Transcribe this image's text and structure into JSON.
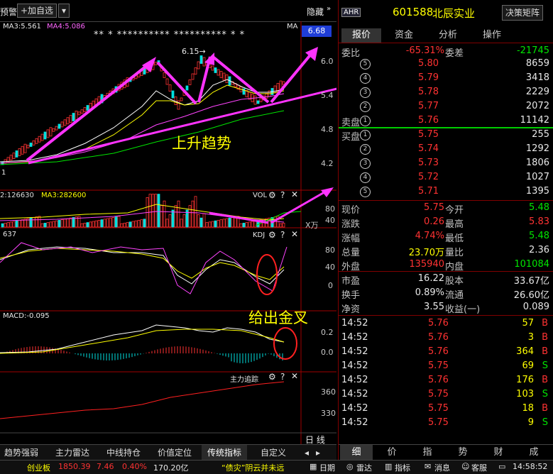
{
  "toolbar": {
    "alert_label": "预警",
    "add_fav_label": "+加自选",
    "hide_label": "隐藏"
  },
  "indicators": {
    "ma3_main": "MA3:5.561",
    "ma4_main": "MA4:5.086",
    "ma_tag": "MA",
    "price_box": "6.68",
    "peak_label": "6.15→",
    "stars": "** * ********** ********** * *",
    "vol_ma2": "2:126630",
    "vol_ma3": "MA3:282600",
    "vol_title": "VOL",
    "vol_unit": "X万",
    "kdj_value": "637",
    "kdj_title": "KDJ",
    "macd_value": "MACD:-0.095",
    "main_track": "主力追踪",
    "left_one": "1"
  },
  "y_axis": {
    "main": [
      "6.0",
      "5.4",
      "4.8",
      "4.2"
    ],
    "vol": [
      "80",
      "40"
    ],
    "kdj": [
      "80",
      "40",
      "0"
    ],
    "macd": [
      "0.2",
      "0.0"
    ],
    "track": [
      "360",
      "330"
    ]
  },
  "annotations": {
    "trend": "上升趋势",
    "golden_cross": "给出金叉"
  },
  "bottom_tabs": [
    "趋势强弱",
    "主力雷达",
    "中线持仓",
    "价值定位",
    "传统指标",
    "自定义"
  ],
  "day_line_label": "日 线",
  "stock": {
    "tag": "AHR",
    "code": "601588",
    "name": "北辰实业",
    "decision_btn": "决策矩阵"
  },
  "right_tabs": [
    "报价",
    "资金",
    "分析",
    "操作"
  ],
  "weibi": {
    "label1": "委比",
    "value1": "-65.31%",
    "label2": "委差",
    "value2": "-21745"
  },
  "sell_label": "卖盘",
  "buy_label": "买盘",
  "asks": [
    {
      "lvl": "5",
      "price": "5.80",
      "vol": "8659"
    },
    {
      "lvl": "4",
      "price": "5.79",
      "vol": "3418"
    },
    {
      "lvl": "3",
      "price": "5.78",
      "vol": "2229"
    },
    {
      "lvl": "2",
      "price": "5.77",
      "vol": "2072"
    },
    {
      "lvl": "1",
      "price": "5.76",
      "vol": "11142"
    }
  ],
  "bids": [
    {
      "lvl": "1",
      "price": "5.75",
      "vol": "255"
    },
    {
      "lvl": "2",
      "price": "5.74",
      "vol": "1292"
    },
    {
      "lvl": "3",
      "price": "5.73",
      "vol": "1806"
    },
    {
      "lvl": "4",
      "price": "5.72",
      "vol": "1027"
    },
    {
      "lvl": "5",
      "price": "5.71",
      "vol": "1395"
    }
  ],
  "stats": [
    {
      "l1": "现价",
      "v1": "5.75",
      "c1": "red",
      "l2": "今开",
      "v2": "5.48",
      "c2": "grn"
    },
    {
      "l1": "涨跌",
      "v1": "0.26",
      "c1": "red",
      "l2": "最高",
      "v2": "5.83",
      "c2": "red"
    },
    {
      "l1": "涨幅",
      "v1": "4.74%",
      "c1": "red",
      "l2": "最低",
      "v2": "5.48",
      "c2": "grn"
    },
    {
      "l1": "总量",
      "v1": "23.70万",
      "c1": "yel",
      "l2": "量比",
      "v2": "2.36",
      "c2": "wht"
    },
    {
      "l1": "外盘",
      "v1": "135940",
      "c1": "red",
      "l2": "内盘",
      "v2": "101084",
      "c2": "grn"
    }
  ],
  "fund": [
    {
      "l1": "市盈",
      "v1": "16.22",
      "l2": "股本",
      "v2": "33.67亿"
    },
    {
      "l1": "换手",
      "v1": "0.89%",
      "l2": "流通",
      "v2": "26.60亿"
    },
    {
      "l1": "净资",
      "v1": "3.55",
      "l2": "收益(一)",
      "v2": "0.089"
    }
  ],
  "ticks": [
    {
      "time": "14:52",
      "price": "5.76",
      "vol": "57",
      "dir": "B"
    },
    {
      "time": "14:52",
      "price": "5.76",
      "vol": "3",
      "dir": "B"
    },
    {
      "time": "14:52",
      "price": "5.76",
      "vol": "364",
      "dir": "B"
    },
    {
      "time": "14:52",
      "price": "5.75",
      "vol": "69",
      "dir": "S"
    },
    {
      "time": "14:52",
      "price": "5.76",
      "vol": "176",
      "dir": "B"
    },
    {
      "time": "14:52",
      "price": "5.75",
      "vol": "103",
      "dir": "S"
    },
    {
      "time": "14:52",
      "price": "5.75",
      "vol": "18",
      "dir": "B"
    },
    {
      "time": "14:52",
      "price": "5.75",
      "vol": "9",
      "dir": "S"
    }
  ],
  "detail_tabs": [
    "细",
    "价",
    "指",
    "势",
    "财",
    "成"
  ],
  "status": {
    "board": "创业板",
    "board_val": "1850.39",
    "board_chg": "7.46",
    "board_pct": "0.40%",
    "board_amt": "170.20亿",
    "news": "“债灾”阴云并未远",
    "b1": "日期",
    "b2": "雷达",
    "b3": "指标",
    "b4": "消息",
    "b5": "客服",
    "clock": "14:58:52"
  },
  "colors": {
    "up": "#ff3232",
    "down": "#00e600",
    "annotation": "#ff33ff",
    "text_yellow": "#ffff00"
  }
}
